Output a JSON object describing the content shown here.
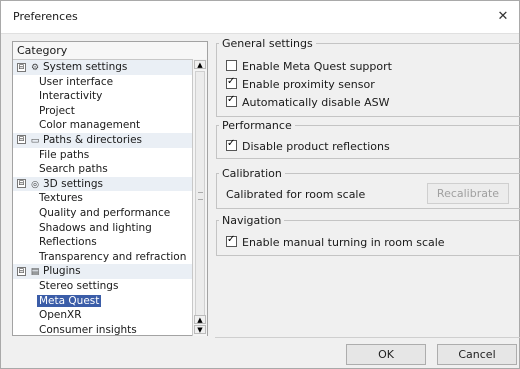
{
  "window": {
    "title": "Preferences",
    "close_glyph": "✕"
  },
  "category": {
    "header": "Category",
    "items": [
      {
        "label": "System settings",
        "level": 0,
        "toggle": "⊟",
        "icon": "gear-icon",
        "glyph": "⚙"
      },
      {
        "label": "User interface",
        "level": 1
      },
      {
        "label": "Interactivity",
        "level": 1
      },
      {
        "label": "Project",
        "level": 1
      },
      {
        "label": "Color management",
        "level": 1
      },
      {
        "label": "Paths & directories",
        "level": 0,
        "toggle": "⊟",
        "icon": "folder-icon",
        "glyph": "▭"
      },
      {
        "label": "File paths",
        "level": 1
      },
      {
        "label": "Search paths",
        "level": 1
      },
      {
        "label": "3D settings",
        "level": 0,
        "toggle": "⊟",
        "icon": "cube-icon",
        "glyph": "◎"
      },
      {
        "label": "Textures",
        "level": 1
      },
      {
        "label": "Quality and performance",
        "level": 1
      },
      {
        "label": "Shadows and lighting",
        "level": 1
      },
      {
        "label": "Reflections",
        "level": 1
      },
      {
        "label": "Transparency and refraction",
        "level": 1
      },
      {
        "label": "Plugins",
        "level": 0,
        "toggle": "⊟",
        "icon": "plugin-icon",
        "glyph": "▤"
      },
      {
        "label": "Stereo settings",
        "level": 1
      },
      {
        "label": "Meta Quest",
        "level": 1,
        "selected": true
      },
      {
        "label": "OpenXR",
        "level": 1
      },
      {
        "label": "Consumer insights",
        "level": 1
      }
    ]
  },
  "general": {
    "legend": "General settings",
    "meta_quest_support": {
      "label": "Enable Meta Quest support",
      "checked": false
    },
    "proximity_sensor": {
      "label": "Enable proximity sensor",
      "checked": true
    },
    "disable_asw": {
      "label": "Automatically disable ASW",
      "checked": true
    }
  },
  "performance": {
    "legend": "Performance",
    "disable_reflections": {
      "label": "Disable product reflections",
      "checked": true
    }
  },
  "calibration": {
    "legend": "Calibration",
    "status": "Calibrated for room scale",
    "recalibrate": "Recalibrate"
  },
  "navigation": {
    "legend": "Navigation",
    "manual_turning": {
      "label": "Enable manual turning in room scale",
      "checked": true
    }
  },
  "footer": {
    "ok": "OK",
    "cancel": "Cancel"
  },
  "colors": {
    "selection": "#3b5da8",
    "group_row": "#eaeff5"
  }
}
